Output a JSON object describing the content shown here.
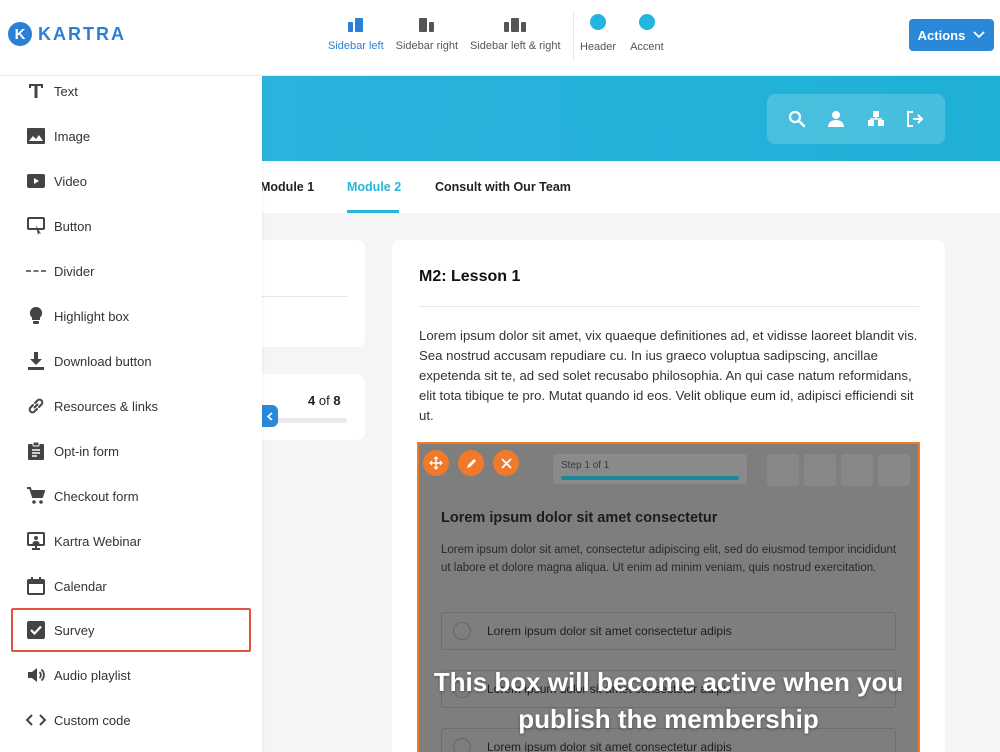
{
  "brand": {
    "logo_letter": "K",
    "name": "KARTRA"
  },
  "layout_options": [
    {
      "label": "Sidebar left",
      "active": true
    },
    {
      "label": "Sidebar right",
      "active": false
    },
    {
      "label": "Sidebar left & right",
      "active": false
    }
  ],
  "color_options": [
    {
      "label": "Header",
      "color": "#22b5e0"
    },
    {
      "label": "Accent",
      "color": "#22b5e0"
    }
  ],
  "actions_button": {
    "label": "Actions"
  },
  "sidebar": {
    "items": [
      {
        "label": "Text",
        "icon": "text-icon"
      },
      {
        "label": "Image",
        "icon": "image-icon"
      },
      {
        "label": "Video",
        "icon": "video-icon"
      },
      {
        "label": "Button",
        "icon": "button-icon"
      },
      {
        "label": "Divider",
        "icon": "divider-icon"
      },
      {
        "label": "Highlight box",
        "icon": "lightbulb-icon"
      },
      {
        "label": "Download button",
        "icon": "download-icon"
      },
      {
        "label": "Resources & links",
        "icon": "link-icon"
      },
      {
        "label": "Opt-in form",
        "icon": "clipboard-icon"
      },
      {
        "label": "Checkout form",
        "icon": "cart-icon"
      },
      {
        "label": "Kartra Webinar",
        "icon": "webinar-icon"
      },
      {
        "label": "Calendar",
        "icon": "calendar-icon"
      },
      {
        "label": "Survey",
        "icon": "checkbox-icon"
      },
      {
        "label": "Audio playlist",
        "icon": "speaker-icon"
      },
      {
        "label": "Custom code",
        "icon": "code-icon"
      }
    ]
  },
  "banner": {
    "icons": [
      "search-icon",
      "user-icon",
      "sitemap-icon",
      "logout-icon"
    ]
  },
  "tabs": [
    {
      "label": "Module 1",
      "active": false
    },
    {
      "label": "Module 2",
      "active": true
    },
    {
      "label": "Consult with Our Team",
      "active": false
    }
  ],
  "progress": {
    "current": "4",
    "of": "of",
    "total": "8",
    "fraction": 0.5
  },
  "lesson": {
    "title": "M2: Lesson 1",
    "body": "Lorem ipsum dolor sit amet, vix quaeque definitiones ad, et vidisse laoreet blandit vis. Sea nostrud accusam repudiare cu. In ius graeco voluptua sadipscing, ancillae expetenda sit te, ad sed solet recusabo philosophia. An qui case natum reformidans, elit tota tibique te pro. Mutat quando id eos. Velit oblique eum id, adipisci efficiendi sit ut."
  },
  "survey": {
    "step_label": "Step 1 of 1",
    "title": "Lorem ipsum dolor sit amet consectetur",
    "body": "Lorem ipsum dolor sit amet, consectetur adipiscing elit, sed do eiusmod tempor incididunt ut labore et dolore magna aliqua. Ut enim ad minim veniam, quis nostrud exercitation.",
    "options": [
      "Lorem ipsum dolor sit amet consectetur adipis",
      "Lorem ipsum dolor sit amet consectetur adipis",
      "Lorem ipsum dolor sit amet consectetur adipis"
    ],
    "overlay_message": "This box will become active when you publish the membership"
  }
}
